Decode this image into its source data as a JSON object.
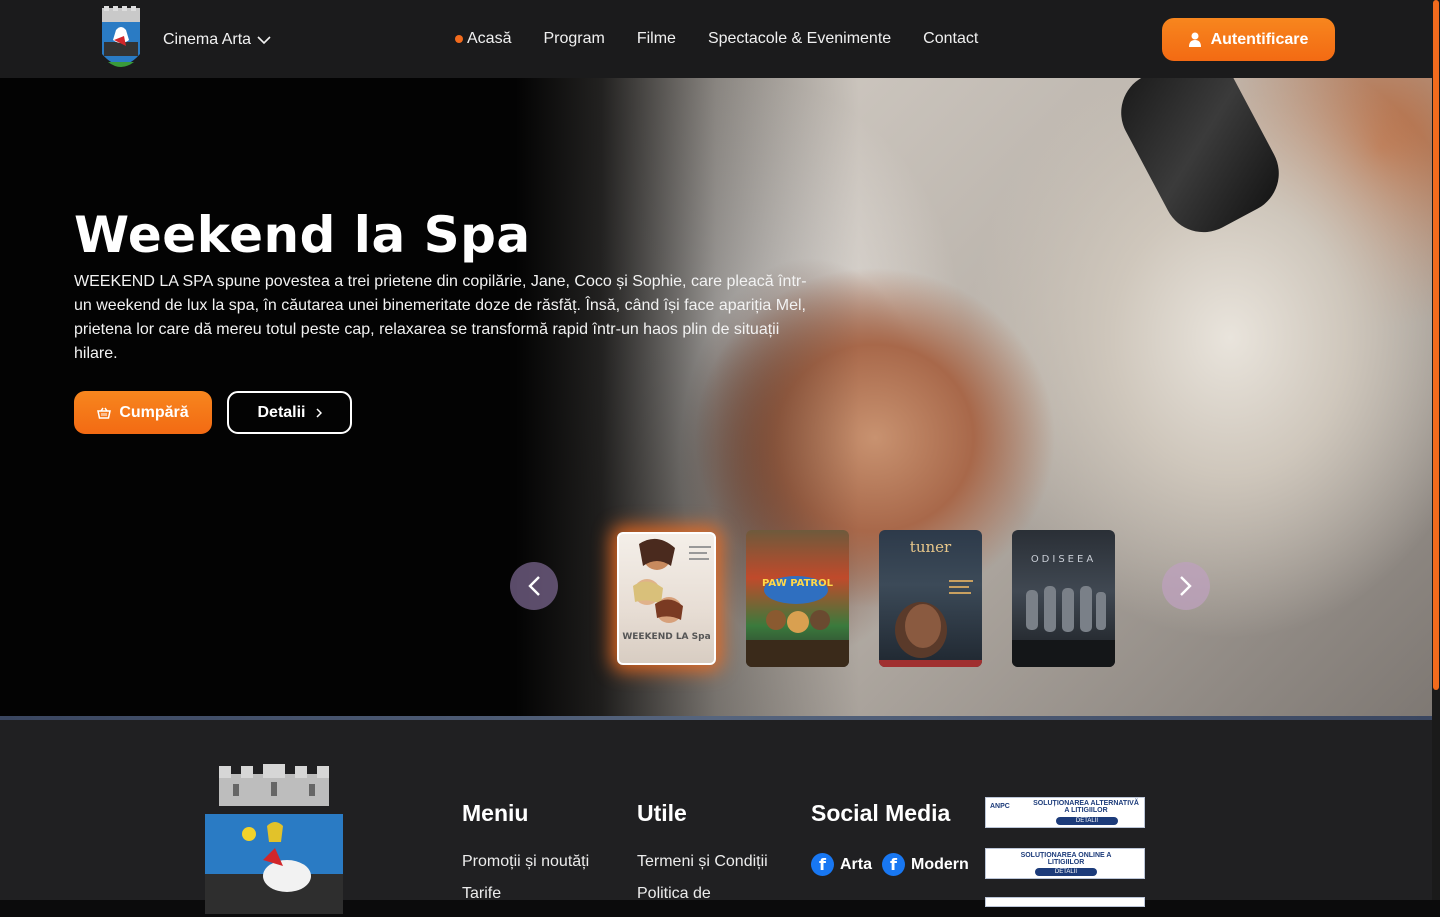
{
  "header": {
    "cinema_name": "Cinema Arta",
    "nav": [
      "Acasă",
      "Program",
      "Filme",
      "Spectacole & Evenimente",
      "Contact"
    ],
    "active_nav": "Acasă",
    "login_label": "Autentificare"
  },
  "hero": {
    "title": "Weekend la Spa",
    "description": "WEEKEND LA SPA spune povestea a trei prietene din copilărie, Jane, Coco și Sophie, care pleacă într-un weekend de lux la spa, în căutarea unei binemeritate doze de răsfăț. Însă, când își face apariția Mel, prietena lor care dă mereu totul peste cap, relaxarea se transformă rapid într-un haos plin de situații hilare.",
    "buy_label": "Cumpără",
    "details_label": "Detalii"
  },
  "carousel": {
    "posters": [
      {
        "label": "WEEKEND LA Spa",
        "active": true
      },
      {
        "label": "PAW PATROL",
        "active": false
      },
      {
        "label": "tuner",
        "active": false
      },
      {
        "label": "ODISEEA",
        "active": false
      }
    ]
  },
  "footer": {
    "menu": {
      "title": "Meniu",
      "links": [
        "Promoții și noutăți",
        "Tarife"
      ]
    },
    "util": {
      "title": "Utile",
      "links": [
        "Termeni și Condiții",
        "Politica de"
      ]
    },
    "social": {
      "title": "Social Media",
      "items": [
        "Arta",
        "Modern"
      ]
    },
    "badges": [
      {
        "text": "SOLUȚIONAREA ALTERNATIVĂ A LITIGIILOR",
        "pill": "DETALII",
        "mark": "ANPC"
      },
      {
        "text": "SOLUȚIONAREA ONLINE A LITIGIILOR",
        "pill": "DETALII"
      }
    ]
  },
  "colors": {
    "accent": "#f26b1d",
    "header_bg": "#1b1b1c",
    "footer_bg": "#202022",
    "facebook": "#1877f2"
  }
}
